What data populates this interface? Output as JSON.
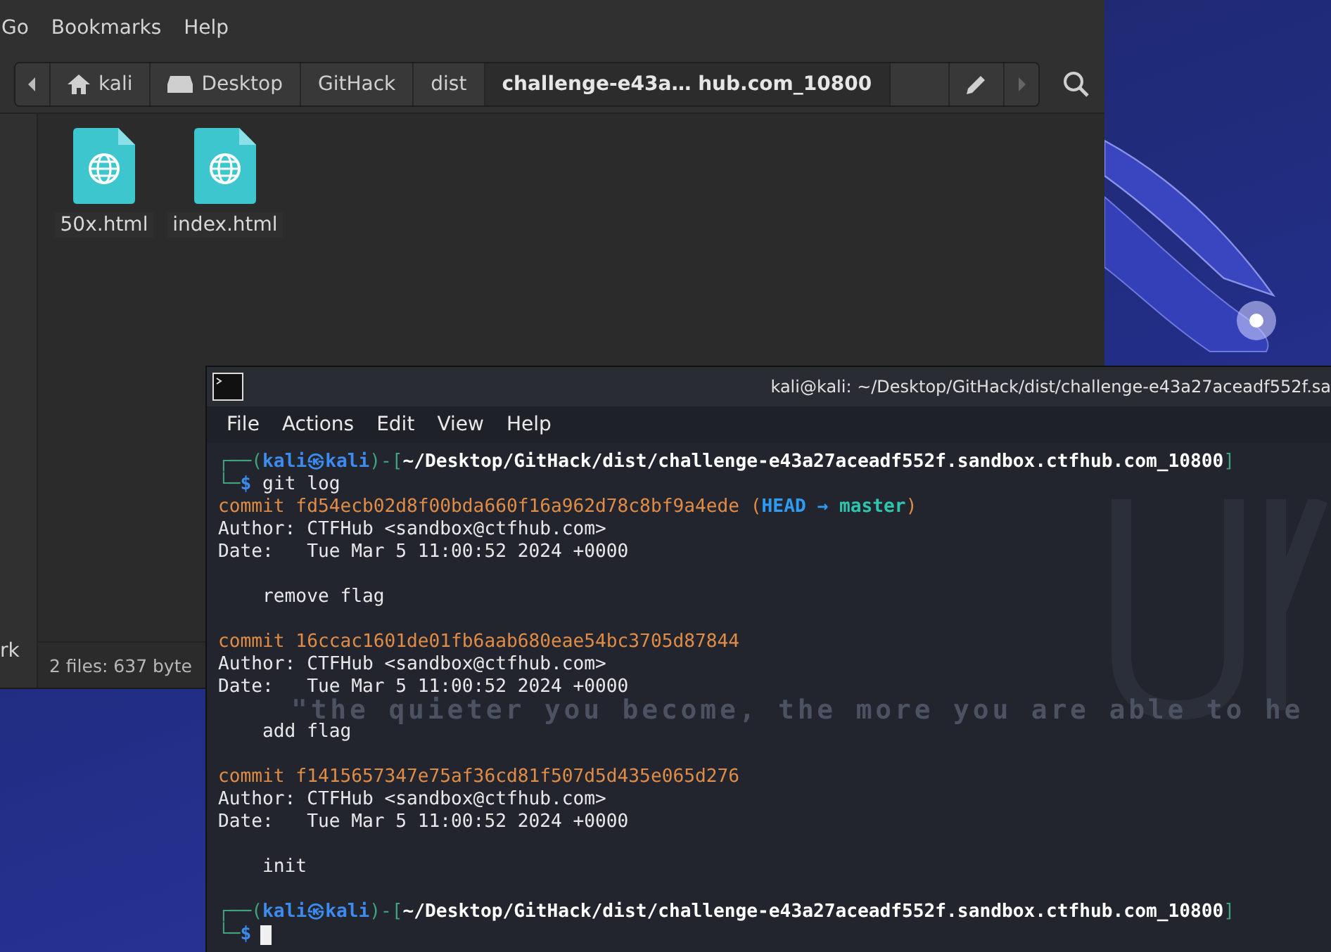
{
  "file_manager": {
    "menu": [
      {
        "label": "Go"
      },
      {
        "label": "Bookmarks"
      },
      {
        "label": "Help"
      }
    ],
    "path": [
      {
        "label": "kali",
        "kind": "home",
        "selected": false
      },
      {
        "label": "Desktop",
        "kind": "drive",
        "selected": false
      },
      {
        "label": "GitHack",
        "kind": "plain",
        "selected": false
      },
      {
        "label": "dist",
        "kind": "plain",
        "selected": false
      },
      {
        "label": "challenge-e43a… hub.com_10800",
        "kind": "plain",
        "selected": true
      }
    ],
    "sidebar_text": "rk",
    "files": [
      {
        "name": "50x.html"
      },
      {
        "name": "index.html"
      }
    ],
    "status": "2 files: 637 byte"
  },
  "terminal": {
    "title": "kali@kali: ~/Desktop/GitHack/dist/challenge-e43a27aceadf552f.sa",
    "menu": [
      {
        "label": "File"
      },
      {
        "label": "Actions"
      },
      {
        "label": "Edit"
      },
      {
        "label": "View"
      },
      {
        "label": "Help"
      }
    ],
    "background_quote": "\"the quieter you become, the more you are able to he",
    "lines": [
      {
        "kind": "prompt",
        "open": "┌──(",
        "user": "kali㉿kali",
        "mid": ")-[",
        "path": "~/Desktop/GitHack/dist/challenge-e43a27aceadf552f.sandbox.ctfhub.com_10800",
        "close": "]",
        "corner": "└─",
        "dollar": "$",
        "command": "git log",
        "cursor": false
      },
      {
        "kind": "commit",
        "label": "commit",
        "hash": "fd54ecb02d8f00bda660f16a962d78c8bf9a4ede",
        "refs": {
          "open": "(",
          "head": "HEAD",
          "arrow": "→",
          "branch": "master",
          "close": ")"
        }
      },
      {
        "kind": "text",
        "text": "Author: CTFHub <sandbox@ctfhub.com>"
      },
      {
        "kind": "text",
        "text": "Date:   Tue Mar 5 11:00:52 2024 +0000"
      },
      {
        "kind": "message",
        "text": "remove flag"
      },
      {
        "kind": "commit",
        "label": "commit",
        "hash": "16ccac1601de01fb6aab680eae54bc3705d87844"
      },
      {
        "kind": "text",
        "text": "Author: CTFHub <sandbox@ctfhub.com>"
      },
      {
        "kind": "text",
        "text": "Date:   Tue Mar 5 11:00:52 2024 +0000"
      },
      {
        "kind": "message",
        "text": "add flag"
      },
      {
        "kind": "commit",
        "label": "commit",
        "hash": "f1415657347e75af36cd81f507d5d435e065d276"
      },
      {
        "kind": "text",
        "text": "Author: CTFHub <sandbox@ctfhub.com>"
      },
      {
        "kind": "text",
        "text": "Date:   Tue Mar 5 11:00:52 2024 +0000"
      },
      {
        "kind": "message",
        "text": "init"
      },
      {
        "kind": "prompt",
        "open": "┌──(",
        "user": "kali㉿kali",
        "mid": ")-[",
        "path": "~/Desktop/GitHack/dist/challenge-e43a27aceadf552f.sandbox.ctfhub.com_10800",
        "close": "]",
        "corner": "└─",
        "dollar": "$",
        "cursor": true
      }
    ]
  }
}
